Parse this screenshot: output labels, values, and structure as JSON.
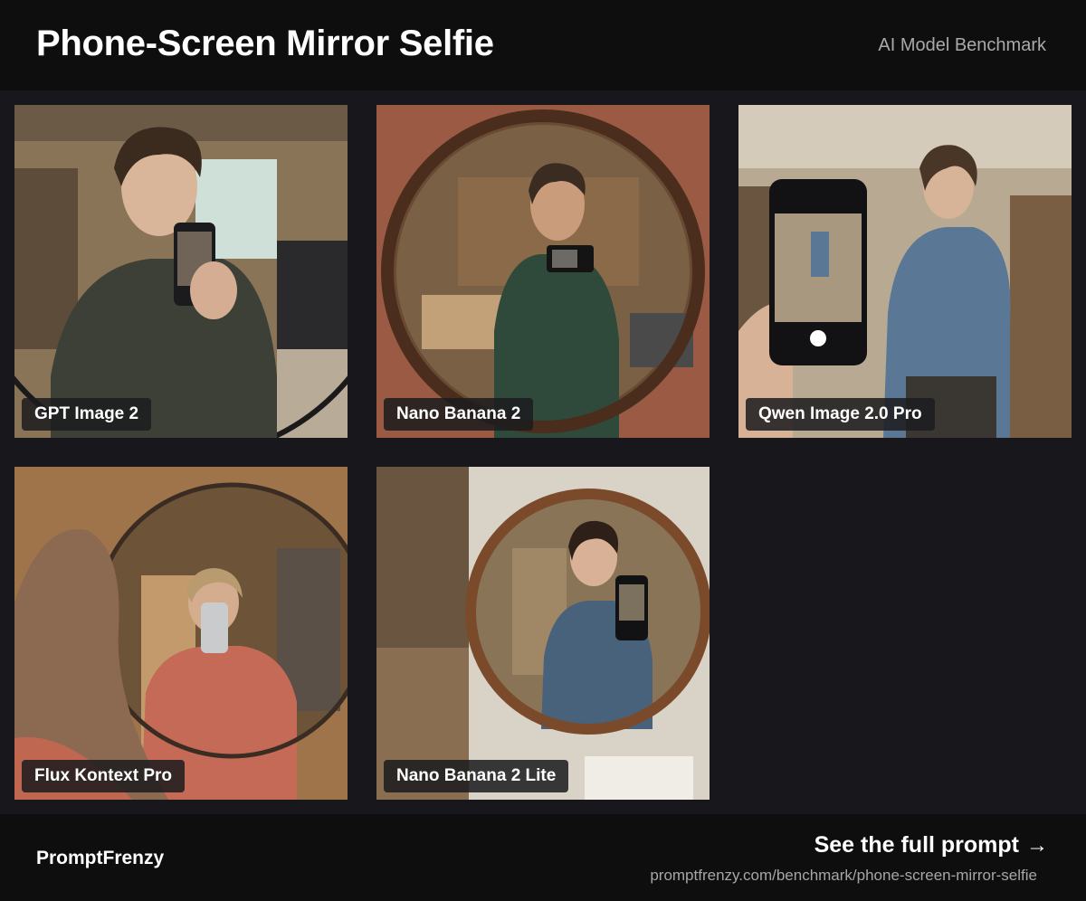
{
  "header": {
    "title": "Phone-Screen Mirror Selfie",
    "subtitle": "AI Model Benchmark"
  },
  "tiles": [
    {
      "label": "GPT Image 2",
      "image": "man in dark sweater taking phone selfie in workshop mirror"
    },
    {
      "label": "Nano Banana 2",
      "image": "man in green shirt in round wooden mirror in workshop"
    },
    {
      "label": "Qwen Image 2.0 Pro",
      "image": "hand holding phone showing woman in denim shirt in workshop"
    },
    {
      "label": "Flux Kontext  Pro",
      "image": "woman in red shirt taking selfie in round mirror"
    },
    {
      "label": "Nano Banana 2 Lite",
      "image": "smiling woman in apron in round wooden mirror in studio"
    }
  ],
  "footer": {
    "brand": "PromptFrenzy",
    "cta": "See the full prompt",
    "cta_icon": "arrow-right-icon",
    "url": "promptfrenzy.com/benchmark/phone-screen-mirror-selfie"
  }
}
